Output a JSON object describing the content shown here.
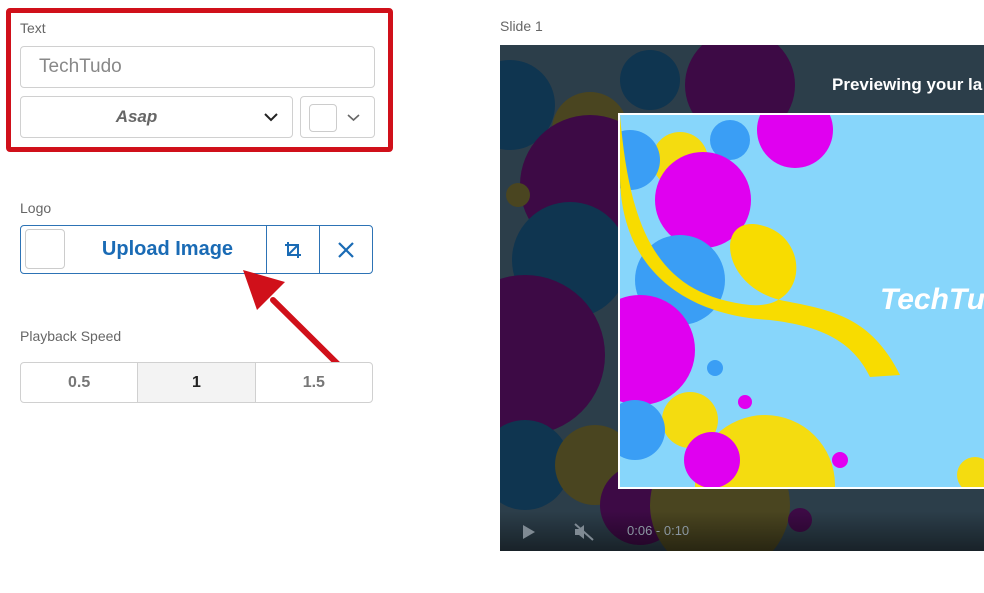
{
  "text_section": {
    "label": "Text",
    "value": "TechTudo",
    "font": "Asap"
  },
  "logo_section": {
    "label": "Logo",
    "upload_label": "Upload Image"
  },
  "playback": {
    "label": "Playback Speed",
    "options": [
      "0.5",
      "1",
      "1.5"
    ],
    "selected": "1"
  },
  "preview": {
    "slide_label": "Slide 1",
    "title": "Previewing your la",
    "slide_text": "TechTu",
    "time": "0:06 - 0:10"
  },
  "colors": {
    "highlight": "#d0101a",
    "accent": "#1a6bb5",
    "slide_bg": "#87d6fb"
  }
}
